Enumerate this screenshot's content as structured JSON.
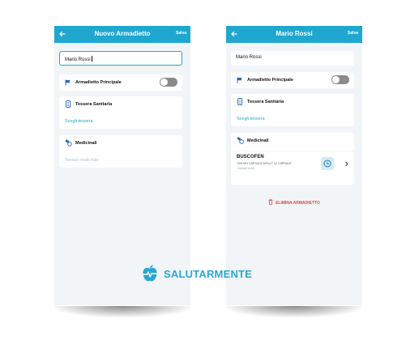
{
  "left_screen": {
    "appbar": {
      "title": "Nuovo Armadietto",
      "save": "Salva"
    },
    "name_value": "Mario Rossi",
    "main_cabinet_label": "Armadietto Principale",
    "main_cabinet_enabled": false,
    "health_card_label": "Tessera Sanitaria",
    "health_card_link": "Scegli tessera",
    "medicines_label": "Medicinali",
    "medicines_empty": "Nessun medicinale"
  },
  "right_screen": {
    "appbar": {
      "title": "Mario Rossi",
      "save": "Salva"
    },
    "name_value": "Mario Rossi",
    "main_cabinet_label": "Armadietto Principale",
    "main_cabinet_enabled": false,
    "health_card_label": "Tessera Sanitaria",
    "health_card_link": "Scegli tessera",
    "medicines_label": "Medicinali",
    "medicine": {
      "name": "BUSCOFEN",
      "description": "\"200 MG CAPSULE MOLLI\" 12 CAPSULE",
      "kind": "Capsule molli"
    },
    "delete_label": "ELIMINA ARMADIETTO"
  },
  "brand": {
    "name": "SALUTARMENTE",
    "color": "#2aa6d2"
  },
  "colors": {
    "accent": "#1fa7cf",
    "danger": "#e2434b",
    "background": "#f2f5f8"
  },
  "icons": [
    "back-arrow-icon",
    "flag-icon",
    "health-card-icon",
    "pills-icon",
    "clock-icon",
    "chevron-right-icon",
    "trash-icon",
    "apple-heartbeat-icon"
  ]
}
